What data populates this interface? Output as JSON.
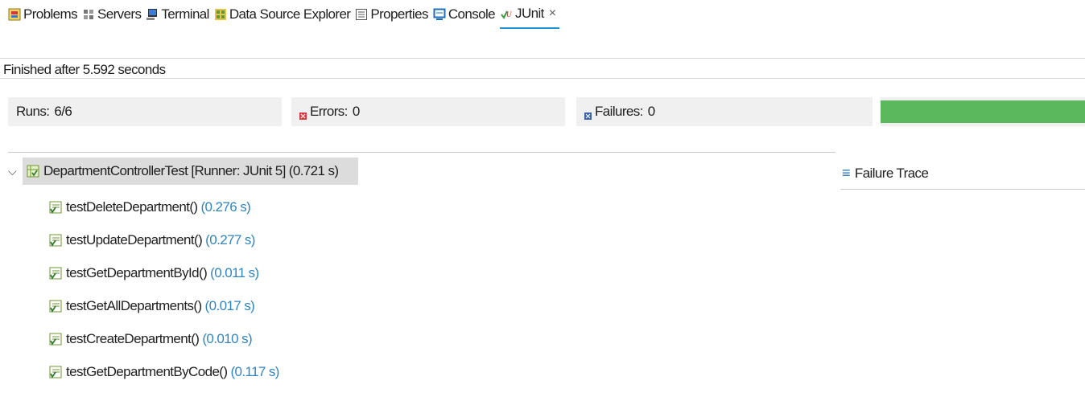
{
  "tabs": [
    {
      "label": "Problems",
      "icon": "problems-icon"
    },
    {
      "label": "Servers",
      "icon": "servers-icon"
    },
    {
      "label": "Terminal",
      "icon": "terminal-icon"
    },
    {
      "label": "Data Source Explorer",
      "icon": "data-source-explorer-icon"
    },
    {
      "label": "Properties",
      "icon": "properties-icon"
    },
    {
      "label": "Console",
      "icon": "console-icon"
    },
    {
      "label": "JUnit",
      "icon": "junit-icon",
      "active": true
    }
  ],
  "close_glyph": "×",
  "status": {
    "text": "Finished after 5.592 seconds"
  },
  "counters": {
    "runs_label": "Runs:",
    "runs_value": "6/6",
    "errors_label": "Errors:",
    "errors_value": "0",
    "failures_label": "Failures:",
    "failures_value": "0"
  },
  "progress": {
    "fraction": 1.0,
    "color": "#5cb85c"
  },
  "tree": {
    "root": {
      "label": "DepartmentControllerTest [Runner: JUnit 5]",
      "time": "(0.721 s)"
    },
    "tests": [
      {
        "name": "testDeleteDepartment()",
        "time": "(0.276 s)"
      },
      {
        "name": "testUpdateDepartment()",
        "time": "(0.277 s)"
      },
      {
        "name": "testGetDepartmentById()",
        "time": "(0.011 s)"
      },
      {
        "name": "testGetAllDepartments()",
        "time": "(0.017 s)"
      },
      {
        "name": "testCreateDepartment()",
        "time": "(0.010 s)"
      },
      {
        "name": "testGetDepartmentByCode()",
        "time": "(0.117 s)"
      }
    ]
  },
  "failure_trace": {
    "label": "Failure Trace"
  },
  "colors": {
    "accent": "#1e8fd3",
    "time_text": "#2e86c1",
    "error_red": "#d9363e",
    "failure_blue": "#3a5fa8"
  }
}
